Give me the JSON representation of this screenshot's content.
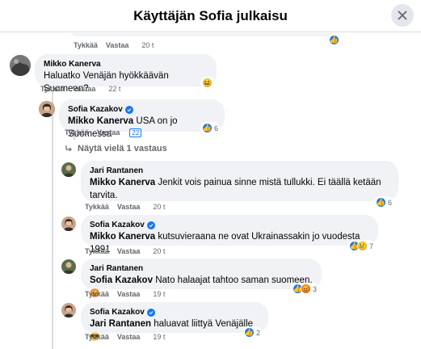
{
  "dialog": {
    "title": "Käyttäjän Sofia julkaisu"
  },
  "top_comment": {
    "actions": {
      "like": "Tykkää",
      "reply": "Vastaa",
      "time": "20 t"
    }
  },
  "comments": [
    {
      "author": "Mikko Kanerva",
      "text": "Haluatko Venäjän hyökkäävän Suomeen?",
      "actions": {
        "like": "Tykkää",
        "reply": "Vastaa",
        "time": "22 t"
      },
      "reaction_icons": [
        "haha"
      ]
    },
    {
      "author": "Sofia Kazakov",
      "verified": true,
      "mention": "Mikko Kanerva",
      "text": "USA on jo Suomessa",
      "actions": {
        "like": "Tykkää",
        "reply": "Vastaa",
        "time": "22"
      },
      "reaction_icons": [
        "like"
      ],
      "reaction_count": "6"
    },
    {
      "author": "Jari Rantanen",
      "mention": "Mikko Kanerva",
      "text": "Jenkit vois painua sinne mistä tullukki. Ei täällä ketään tarvita.",
      "actions": {
        "like": "Tykkää",
        "reply": "Vastaa",
        "time": "20 t"
      },
      "reaction_icons": [
        "like"
      ],
      "reaction_count": "6"
    },
    {
      "author": "Sofia Kazakov",
      "verified": true,
      "mention": "Mikko Kanerva",
      "text": "kutsuvieraana ne ovat Ukrainassakin jo vuodesta 1991",
      "actions": {
        "like": "Tykkää",
        "reply": "Vastaa",
        "time": "20 t"
      },
      "reaction_icons": [
        "like",
        "sad"
      ],
      "reaction_count": "7"
    },
    {
      "author": "Jari Rantanen",
      "mention": "Sofia Kazakov",
      "text": "Nato halaajat tahtoo saman suomeen.",
      "actions": {
        "like": "Tykkää",
        "reply": "Vastaa",
        "time": "19 t"
      },
      "reaction_icons": [
        "like",
        "angry"
      ],
      "reaction_count": "3"
    },
    {
      "author": "Sofia Kazakov",
      "verified": true,
      "mention": "Jari Rantanen",
      "text": "haluavat liittyä Venäjälle",
      "actions": {
        "like": "Tykkää",
        "reply": "Vastaa",
        "time": "19 t"
      },
      "reaction_icons": [
        "like"
      ],
      "reaction_count": "2"
    }
  ],
  "more_replies": "Näytä vielä 1 vastaus",
  "colors": {
    "accent": "#1877f2",
    "bubble": "#f0f2f5",
    "muted": "#65676b"
  }
}
